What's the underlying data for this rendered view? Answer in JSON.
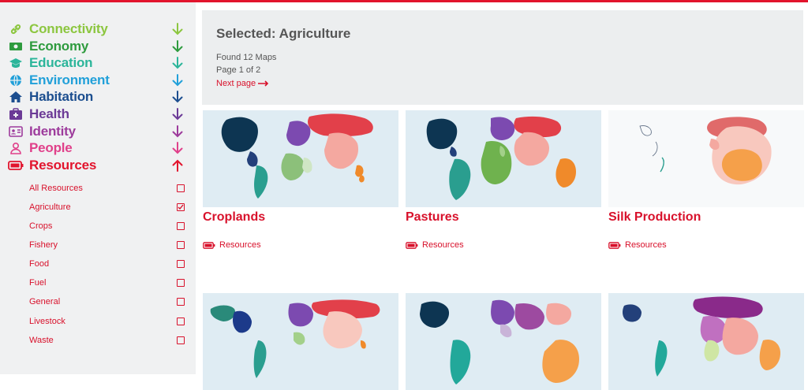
{
  "sidebar": {
    "categories": [
      {
        "label": "Connectivity",
        "color": "#8cc63f",
        "icon": "link-icon"
      },
      {
        "label": "Economy",
        "color": "#2e9b3e",
        "icon": "money-icon"
      },
      {
        "label": "Education",
        "color": "#2bb59a",
        "icon": "graduation-cap-icon"
      },
      {
        "label": "Environment",
        "color": "#21a0d9",
        "icon": "globe-icon"
      },
      {
        "label": "Habitation",
        "color": "#1c4e8f",
        "icon": "house-icon"
      },
      {
        "label": "Health",
        "color": "#6b3a96",
        "icon": "medical-kit-icon"
      },
      {
        "label": "Identity",
        "color": "#9d3b9c",
        "icon": "id-card-icon"
      },
      {
        "label": "People",
        "color": "#e0408a",
        "icon": "person-icon"
      },
      {
        "label": "Resources",
        "color": "#e2142d",
        "icon": "battery-icon"
      }
    ],
    "subcategories": [
      {
        "label": "All Resources",
        "checked": false
      },
      {
        "label": "Agriculture",
        "checked": true
      },
      {
        "label": "Crops",
        "checked": false
      },
      {
        "label": "Fishery",
        "checked": false
      },
      {
        "label": "Food",
        "checked": false
      },
      {
        "label": "Fuel",
        "checked": false
      },
      {
        "label": "General",
        "checked": false
      },
      {
        "label": "Livestock",
        "checked": false
      },
      {
        "label": "Waste",
        "checked": false
      }
    ]
  },
  "header": {
    "title": "Selected: Agriculture",
    "found": "Found 12 Maps",
    "page": "Page 1 of 2",
    "next": "Next page"
  },
  "cards": [
    {
      "title": "Croplands",
      "tag": "Resources"
    },
    {
      "title": "Pastures",
      "tag": "Resources"
    },
    {
      "title": "Silk Production",
      "tag": "Resources"
    },
    {
      "title": "",
      "tag": ""
    },
    {
      "title": "",
      "tag": ""
    },
    {
      "title": "",
      "tag": ""
    }
  ],
  "colors": {
    "accent": "#d8112b",
    "map_ocean": "#dfecf3"
  }
}
